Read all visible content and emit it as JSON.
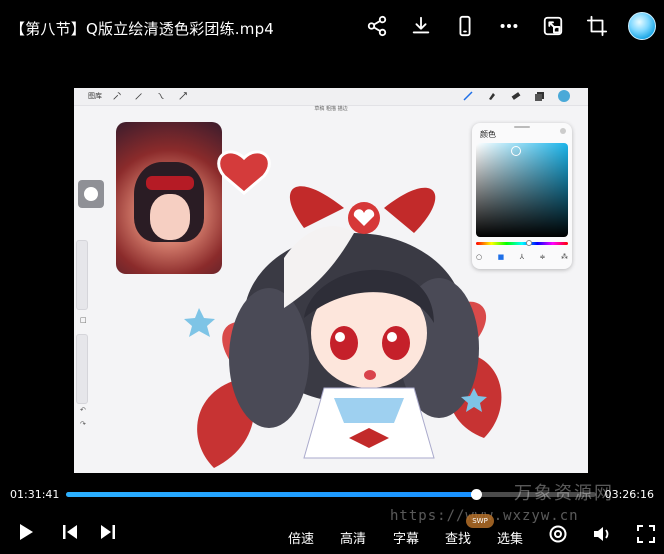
{
  "header": {
    "title": "【第八节】Q版立绘清透色彩团练.mp4",
    "icons": [
      "share-icon",
      "download-icon",
      "phone-icon",
      "more-icon",
      "pip-icon",
      "crop-icon",
      "avatar"
    ]
  },
  "video": {
    "app_toolbar": {
      "gallery_label": "图库",
      "doc_title": "草稿 粗描 描边"
    },
    "color_panel": {
      "title": "颜色",
      "accent": "#1ab4ea"
    }
  },
  "player": {
    "current_time": "01:31:41",
    "total_time": "03:26:16",
    "progress": 0.773,
    "buttons": {
      "speed": "倍速",
      "quality": "高清",
      "subtitles": "字幕",
      "search": "查找",
      "episodes": "选集"
    }
  },
  "watermark": {
    "url": "https://www.wxzyw.cn",
    "site_name": "万象资源网",
    "badge": "SWP"
  }
}
